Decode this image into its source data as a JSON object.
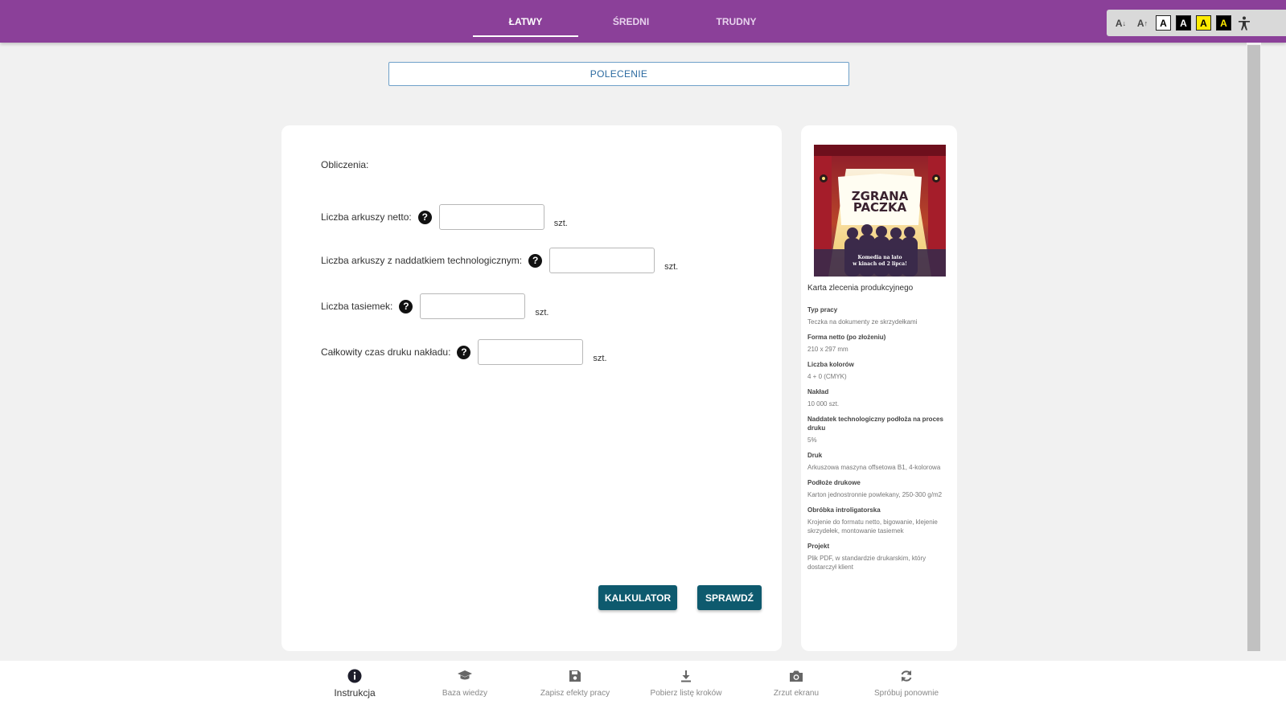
{
  "header": {
    "tabs": [
      {
        "label": "ŁATWY",
        "active": true
      },
      {
        "label": "ŚREDNI",
        "active": false
      },
      {
        "label": "TRUDNY",
        "active": false
      }
    ],
    "accessibility": {
      "decrease_font": "A",
      "increase_font": "A",
      "contrast_white": "A",
      "contrast_black": "A",
      "contrast_yellow": "A",
      "contrast_black_yellow": "A",
      "person_icon": "accessibility-icon"
    }
  },
  "polecenie": {
    "label": "POLECENIE"
  },
  "main": {
    "section_title": "Obliczenia:",
    "fields": [
      {
        "label": "Liczba arkuszy netto:",
        "unit": "szt.",
        "value": ""
      },
      {
        "label": "Liczba arkuszy z naddatkiem technologicznym:",
        "unit": "szt.",
        "value": ""
      },
      {
        "label": "Liczba tasiemek:",
        "unit": "szt.",
        "value": ""
      },
      {
        "label": "Całkowity czas druku nakładu:",
        "unit": "szt.",
        "value": ""
      }
    ],
    "help_symbol": "?",
    "buttons": {
      "calculator": "KALKULATOR",
      "check": "SPRAWDŹ"
    }
  },
  "side": {
    "poster": {
      "title_line1": "ZGRANA",
      "title_line2": "PACZKA",
      "tagline_line1": "Komedia na lato",
      "tagline_line2": "w kinach od 2 lipca!"
    },
    "title": "Karta zlecenia produkcyjnego",
    "items": [
      {
        "label": "Typ pracy",
        "value": "Teczka na dokumenty ze skrzydełkami"
      },
      {
        "label": "Forma netto (po złożeniu)",
        "value": "210 x 297 mm"
      },
      {
        "label": "Liczba kolorów",
        "value": "4 + 0 (CMYK)"
      },
      {
        "label": "Nakład",
        "value": "10 000 szt."
      },
      {
        "label": "Naddatek technologiczny podłoża na proces druku",
        "value": "5%"
      },
      {
        "label": "Druk",
        "value": "Arkuszowa maszyna offsetowa B1, 4-kolorowa"
      },
      {
        "label": "Podłoże drukowe",
        "value": "Karton jednostronnie powlekany, 250-300 g/m2"
      },
      {
        "label": "Obróbka introligatorska",
        "value": "Krojenie do formatu netto, bigowanie, klejenie skrzydełek, montowanie tasiemek"
      },
      {
        "label": "Projekt",
        "value": "Plik PDF, w standardzie drukarskim, który dostarczył klient"
      }
    ]
  },
  "footer": {
    "items": [
      {
        "label": "Instrukcja",
        "icon": "info-icon",
        "active": true
      },
      {
        "label": "Baza wiedzy",
        "icon": "graduation-cap-icon",
        "active": false
      },
      {
        "label": "Zapisz efekty pracy",
        "icon": "save-icon",
        "active": false
      },
      {
        "label": "Pobierz listę kroków",
        "icon": "download-icon",
        "active": false
      },
      {
        "label": "Zrzut ekranu",
        "icon": "camera-icon",
        "active": false
      },
      {
        "label": "Spróbuj ponownie",
        "icon": "refresh-icon",
        "active": false
      }
    ]
  },
  "colors": {
    "header_bg": "#8b4099",
    "button_bg": "#0e5a6e",
    "polecenie_border": "#6fa0c9"
  }
}
